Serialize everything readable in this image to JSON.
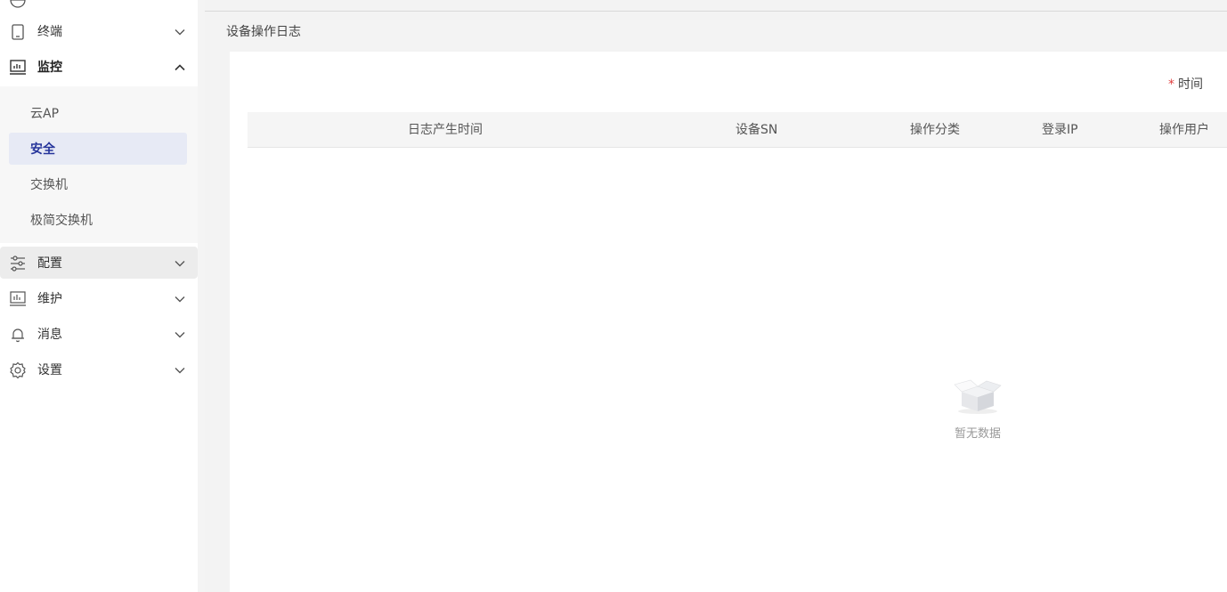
{
  "sidebar": {
    "menu": [
      {
        "label": "终端"
      },
      {
        "label": "监控"
      },
      {
        "label": "配置"
      },
      {
        "label": "维护"
      },
      {
        "label": "消息"
      },
      {
        "label": "设置"
      }
    ],
    "monitor_submenu": [
      {
        "label": "云AP"
      },
      {
        "label": "安全",
        "active": true
      },
      {
        "label": "交换机"
      },
      {
        "label": "极简交换机"
      }
    ]
  },
  "main": {
    "breadcrumb": "设备操作日志",
    "filter": {
      "required_mark": "*",
      "label": "时间"
    },
    "table": {
      "columns": [
        "日志产生时间",
        "设备SN",
        "操作分类",
        "登录IP",
        "操作用户"
      ]
    },
    "empty_state": {
      "text": "暂无数据",
      "icon": "empty-box-icon"
    }
  },
  "colors": {
    "accent": "#26359b",
    "active_bg": "#e7eaf5",
    "required": "#e04040"
  }
}
